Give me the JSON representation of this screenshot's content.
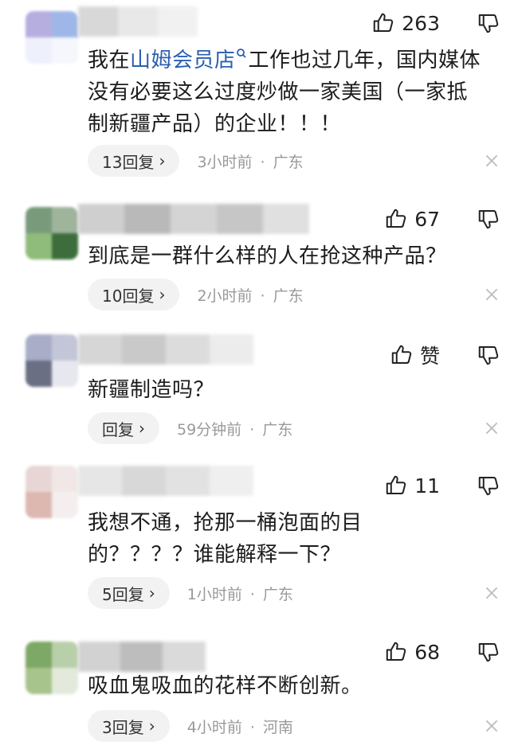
{
  "comments": [
    {
      "likes": "263",
      "link_text": "山姆会员店",
      "text_before": "我在",
      "text_after": "工作也过几年，国内媒体没有必要这么过度炒做一家美国（一家抵制新疆产品）的企业！！！",
      "reply": "13回复",
      "time": "3小时前",
      "location": "广东"
    },
    {
      "likes": "67",
      "text": "到底是一群什么样的人在抢这种产品？",
      "reply": "10回复",
      "time": "2小时前",
      "location": "广东"
    },
    {
      "likes": "赞",
      "text": "新疆制造吗？",
      "reply": "回复",
      "time": "59分钟前",
      "location": "广东"
    },
    {
      "likes": "11",
      "text": "我想不通，抢那一桶泡面的目的？？？？谁能解释一下？",
      "reply": "5回复",
      "time": "1小时前",
      "location": "广东"
    },
    {
      "likes": "68",
      "text": "吸血鬼吸血的花样不断创新。",
      "reply": "3回复",
      "time": "4小时前",
      "location": "河南"
    }
  ],
  "icons": {
    "like": "thumbs-up-icon",
    "dislike": "thumbs-down-icon",
    "close": "close-icon",
    "search": "search-icon",
    "chevron": "chevron-right-icon"
  },
  "colors": {
    "link": "#2a5fb0",
    "meta": "#999999",
    "reply_bg": "#f2f2f2"
  }
}
